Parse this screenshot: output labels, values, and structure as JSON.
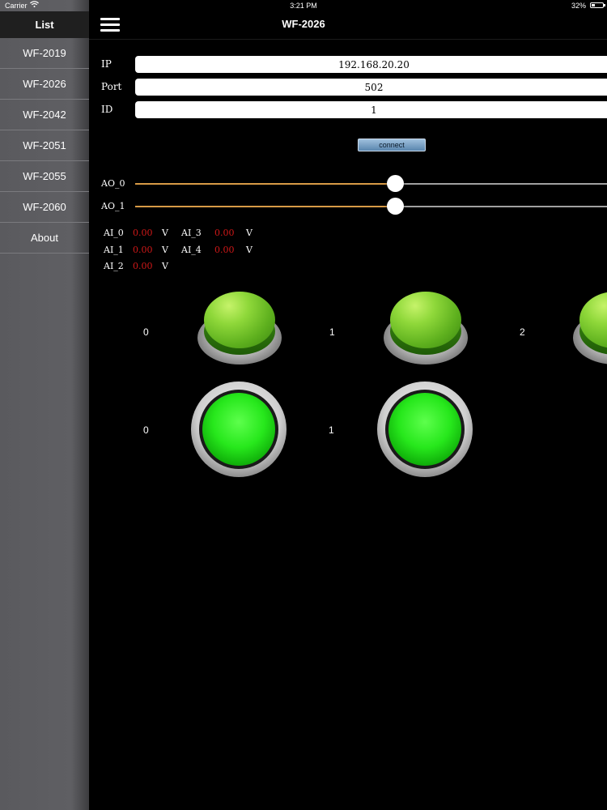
{
  "status_bar": {
    "carrier": "Carrier",
    "time": "3:21 PM",
    "battery": "32%"
  },
  "sidebar": {
    "title": "List",
    "items": [
      {
        "label": "WF-2019"
      },
      {
        "label": "WF-2026"
      },
      {
        "label": "WF-2042"
      },
      {
        "label": "WF-2051"
      },
      {
        "label": "WF-2055"
      },
      {
        "label": "WF-2060"
      },
      {
        "label": "About"
      }
    ]
  },
  "header": {
    "title": "WF-2026"
  },
  "form": {
    "ip_label": "IP",
    "ip_value": "192.168.20.20",
    "port_label": "Port",
    "port_value": "502",
    "id_label": "ID",
    "id_value": "1",
    "connect_label": "connect"
  },
  "analog_outputs": [
    {
      "label": "AO_0",
      "level": 0.55
    },
    {
      "label": "AO_1",
      "level": 0.55
    }
  ],
  "analog_inputs": [
    {
      "label": "AI_0",
      "value": "0.00",
      "unit": "V"
    },
    {
      "label": "AI_1",
      "value": "0.00",
      "unit": "V"
    },
    {
      "label": "AI_2",
      "value": "0.00",
      "unit": "V"
    },
    {
      "label": "AI_3",
      "value": "0.00",
      "unit": "V"
    },
    {
      "label": "AI_4",
      "value": "0.00",
      "unit": "V"
    }
  ],
  "digital_outputs": [
    {
      "label": "0"
    },
    {
      "label": "1"
    },
    {
      "label": "2"
    }
  ],
  "digital_inputs": [
    {
      "label": "0"
    },
    {
      "label": "1"
    }
  ],
  "colors": {
    "slider_fill": "#d79a46",
    "ai_value": "#d01818",
    "led_on": "#27e81c"
  }
}
